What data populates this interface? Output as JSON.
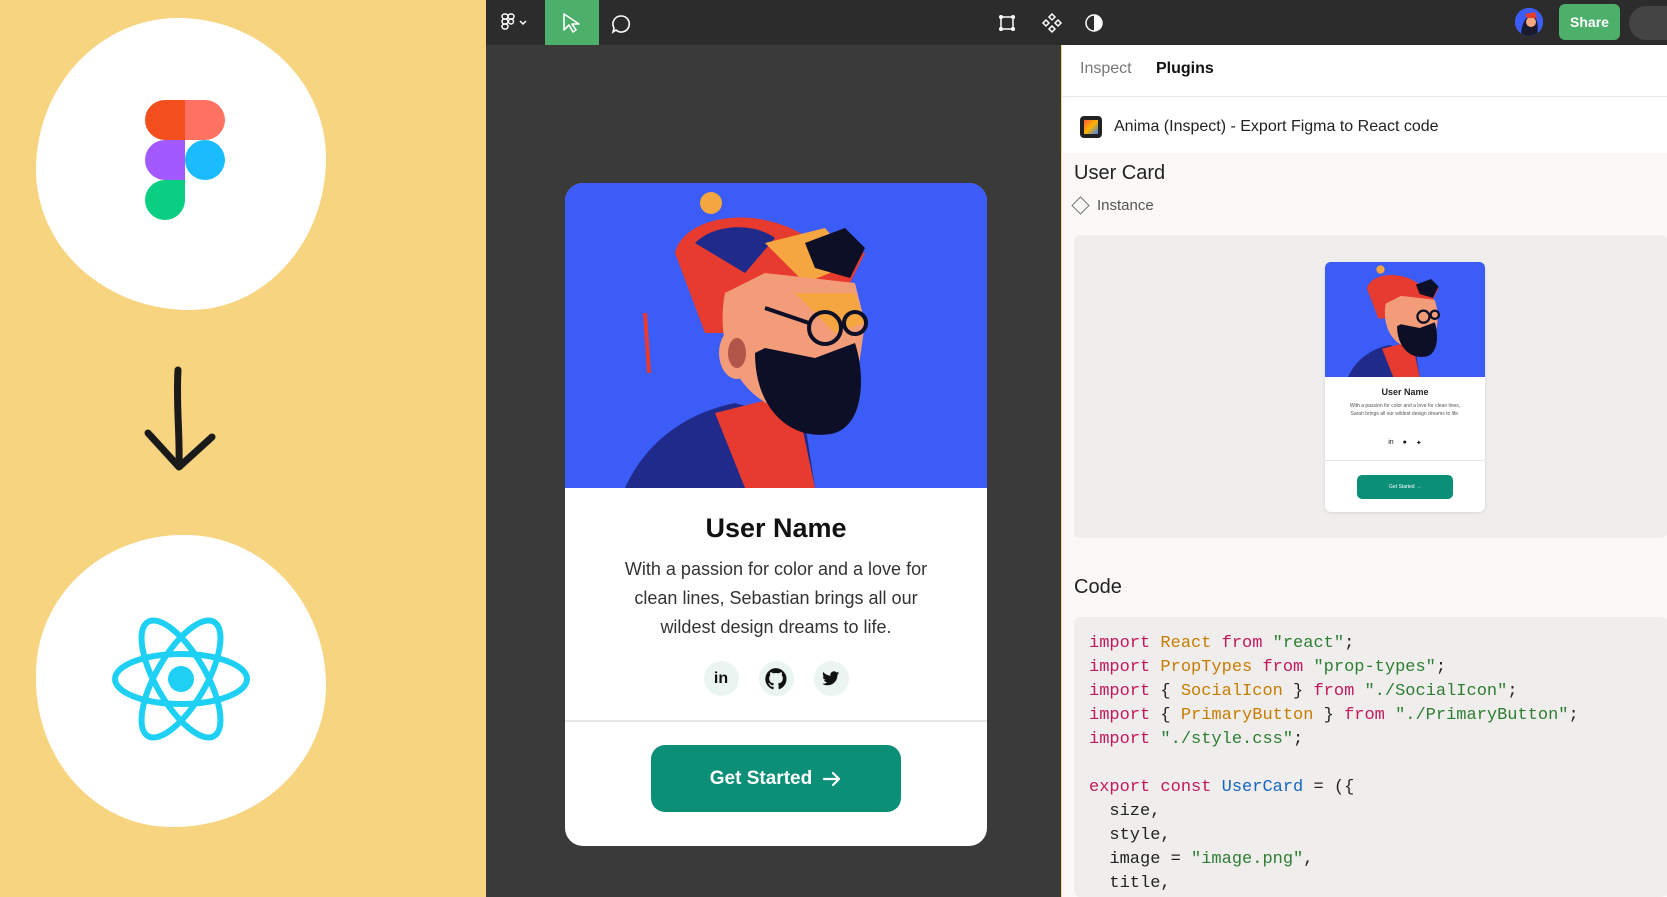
{
  "toolbar": {
    "share_label": "Share"
  },
  "card": {
    "name": "User Name",
    "description": "With a passion for color and a love for clean lines, Sebastian brings all our wildest design dreams to life.",
    "socials": [
      "in",
      "github",
      "twitter"
    ],
    "button_label": "Get Started"
  },
  "panel": {
    "tabs": [
      "Inspect",
      "Plugins"
    ],
    "active_tab": "Plugins",
    "plugin_name": "Anima (Inspect) - Export Figma to React code",
    "component_title": "User Card",
    "component_type": "Instance",
    "preview": {
      "name": "User Name",
      "description": "With a passion for color and a love for clean lines, Sarah brings all our wildest design dreams to life.",
      "button_label": "Get Started →"
    },
    "code_title": "Code",
    "code_lines": [
      [
        [
          "kw",
          "import"
        ],
        [
          "pl",
          " "
        ],
        [
          "id",
          "React"
        ],
        [
          "pl",
          " "
        ],
        [
          "kw",
          "from"
        ],
        [
          "pl",
          " "
        ],
        [
          "st",
          "\"react\""
        ],
        [
          "pl",
          ";"
        ]
      ],
      [
        [
          "kw",
          "import"
        ],
        [
          "pl",
          " "
        ],
        [
          "id",
          "PropTypes"
        ],
        [
          "pl",
          " "
        ],
        [
          "kw",
          "from"
        ],
        [
          "pl",
          " "
        ],
        [
          "st",
          "\"prop-types\""
        ],
        [
          "pl",
          ";"
        ]
      ],
      [
        [
          "kw",
          "import"
        ],
        [
          "pl",
          " { "
        ],
        [
          "id",
          "SocialIcon"
        ],
        [
          "pl",
          " } "
        ],
        [
          "kw",
          "from"
        ],
        [
          "pl",
          " "
        ],
        [
          "st",
          "\"./SocialIcon\""
        ],
        [
          "pl",
          ";"
        ]
      ],
      [
        [
          "kw",
          "import"
        ],
        [
          "pl",
          " { "
        ],
        [
          "id",
          "PrimaryButton"
        ],
        [
          "pl",
          " } "
        ],
        [
          "kw",
          "from"
        ],
        [
          "pl",
          " "
        ],
        [
          "st",
          "\"./PrimaryButton\""
        ],
        [
          "pl",
          ";"
        ]
      ],
      [
        [
          "kw",
          "import"
        ],
        [
          "pl",
          " "
        ],
        [
          "st",
          "\"./style.css\""
        ],
        [
          "pl",
          ";"
        ]
      ],
      [
        [
          "pl",
          ""
        ]
      ],
      [
        [
          "kw",
          "export"
        ],
        [
          "pl",
          " "
        ],
        [
          "kw",
          "const"
        ],
        [
          "pl",
          " "
        ],
        [
          "fn",
          "UserCard"
        ],
        [
          "pl",
          " = ({"
        ]
      ],
      [
        [
          "pl",
          "  size,"
        ]
      ],
      [
        [
          "pl",
          "  style,"
        ]
      ],
      [
        [
          "pl",
          "  image = "
        ],
        [
          "st",
          "\"image.png\""
        ],
        [
          "pl",
          ","
        ]
      ],
      [
        [
          "pl",
          "  title,"
        ]
      ]
    ]
  }
}
